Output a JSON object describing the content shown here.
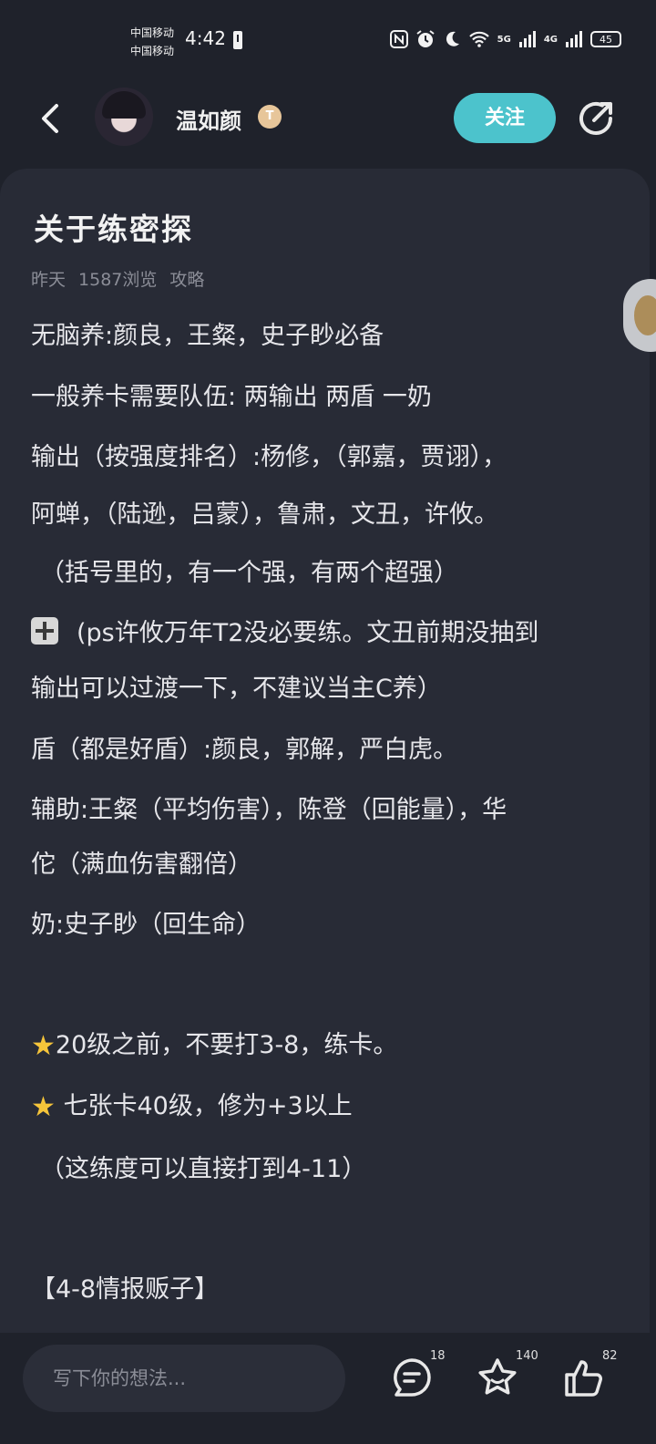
{
  "status_bar": {
    "carrier_1": "中国移动",
    "carrier_2": "中国移动",
    "time": "4:42",
    "net_5g": "5G",
    "net_4g": "4G",
    "battery": "45"
  },
  "header": {
    "username": "温如颜",
    "badge": "T",
    "follow_label": "关注"
  },
  "post": {
    "title": "关于练密探",
    "meta": {
      "time": "昨天",
      "views": "1587浏览",
      "category": "攻略"
    },
    "lines": [
      "无脑养:颜良，王粲，史子眇必备",
      "一般养卡需要队伍:    两输出 两盾 一奶",
      "输出（按强度排名）:杨修，（郭嘉，贾诩），",
      "阿蝉，（陆逊，吕蒙），鲁肃，文丑，许攸。",
      "（括号里的，有一个强，有两个超强）",
      "(ps许攸万年T2没必要练。文丑前期没抽到",
      "输出可以过渡一下，不建议当主C养）",
      "盾（都是好盾）:颜良，郭解，严白虎。",
      "辅助:王粲（平均伤害），陈登（回能量），华",
      "佗（满血伤害翻倍）",
      "奶:史子眇（回生命）",
      "20级之前，不要打3-8，练卡。",
      " 七张卡40级，修为+3以上",
      "（这练度可以直接打到4-11）",
      "【4-8情报贩子】"
    ]
  },
  "bottom_bar": {
    "placeholder": "写下你的想法...",
    "comments_count": "18",
    "favorites_count": "140",
    "likes_count": "82"
  },
  "colors": {
    "accent": "#4cc3cc",
    "background": "#1f222b",
    "card": "#282b36",
    "star": "#f6c53a"
  }
}
